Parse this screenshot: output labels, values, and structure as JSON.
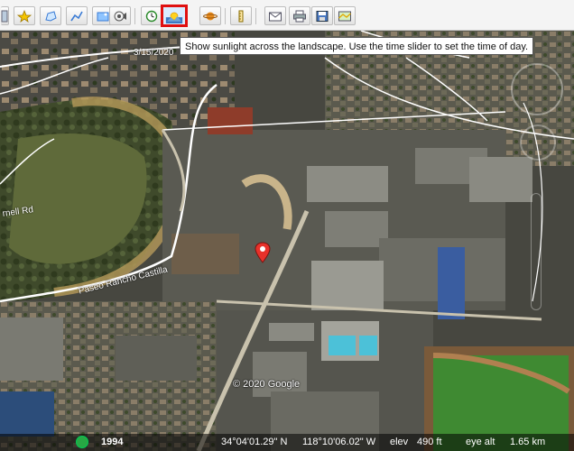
{
  "toolbar": {
    "buttons": [
      {
        "name": "hide-sidebar-button",
        "icon": "sidebar-icon"
      },
      {
        "name": "add-placemark-button",
        "icon": "pushpin-icon"
      },
      {
        "name": "add-polygon-button",
        "icon": "polygon-icon"
      },
      {
        "name": "add-path-button",
        "icon": "path-icon"
      },
      {
        "name": "add-image-overlay-button",
        "icon": "image-overlay-icon"
      },
      {
        "name": "record-tour-button",
        "icon": "record-tour-icon"
      },
      {
        "name": "historical-imagery-button",
        "icon": "clock-icon"
      },
      {
        "name": "sunlight-button",
        "icon": "sun-icon"
      },
      {
        "name": "switch-planet-button",
        "icon": "planet-icon"
      },
      {
        "name": "ruler-button",
        "icon": "ruler-icon"
      },
      {
        "name": "email-button",
        "icon": "envelope-icon"
      },
      {
        "name": "print-button",
        "icon": "printer-icon"
      },
      {
        "name": "save-image-button",
        "icon": "save-image-icon"
      },
      {
        "name": "view-in-maps-button",
        "icon": "maps-icon"
      }
    ],
    "active_button": "sunlight-button"
  },
  "tooltip": {
    "text": "Show sunlight across the landscape. Use the time slider to set the time of day."
  },
  "map": {
    "date_label": "3/15/2020",
    "road_labels": {
      "paseo": "Paseo Rancho Castilla",
      "farnell": "rnell Rd"
    },
    "copyright": "© 2020 Google"
  },
  "status": {
    "imagery_year": "1994",
    "latitude": "34°04'01.29\" N",
    "longitude": "118°10'06.02\" W",
    "elev_label": "elev",
    "elevation": "490 ft",
    "eye_label": "eye alt",
    "eye_alt": "1.65 km"
  },
  "colors": {
    "active_border": "#e01010",
    "toolbar_bg": "#f4f4f4"
  }
}
